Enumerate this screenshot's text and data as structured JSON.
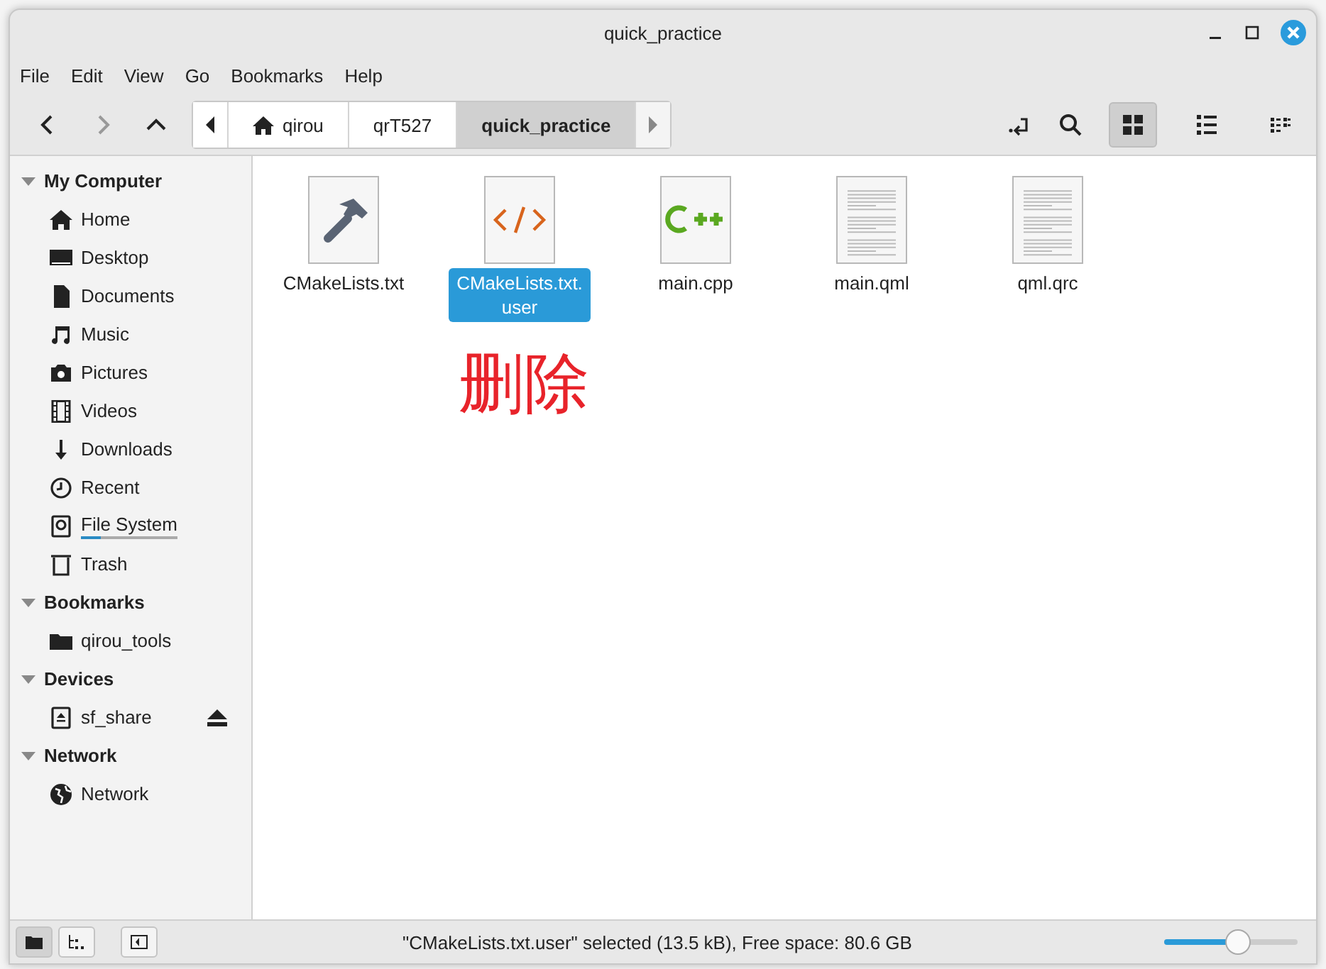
{
  "window": {
    "title": "quick_practice"
  },
  "menu": [
    "File",
    "Edit",
    "View",
    "Go",
    "Bookmarks",
    "Help"
  ],
  "breadcrumbs": [
    {
      "label": "qirou",
      "selected": false
    },
    {
      "label": "qrT527",
      "selected": false
    },
    {
      "label": "quick_practice",
      "selected": true
    }
  ],
  "view_modes": [
    {
      "selected": true
    },
    {
      "selected": false
    },
    {
      "selected": false
    }
  ],
  "sidebar": [
    {
      "label": "My Computer",
      "expanded": true,
      "children": [
        {
          "label": "Home"
        },
        {
          "label": "Desktop"
        },
        {
          "label": "Documents"
        },
        {
          "label": "Music"
        },
        {
          "label": "Pictures"
        },
        {
          "label": "Videos"
        },
        {
          "label": "Downloads"
        },
        {
          "label": "Recent"
        },
        {
          "label": "File System",
          "level": 0.2
        },
        {
          "label": "Trash"
        }
      ]
    },
    {
      "label": "Bookmarks",
      "expanded": true,
      "children": [
        {
          "label": "qirou_tools"
        }
      ]
    },
    {
      "label": "Devices",
      "expanded": true,
      "children": [
        {
          "label": "sf_share"
        }
      ]
    },
    {
      "label": "Network",
      "expanded": true,
      "children": [
        {
          "label": "Network"
        }
      ]
    }
  ],
  "files": [
    {
      "name": "CMakeLists.txt",
      "kind": "cmake",
      "selected": false
    },
    {
      "name": "CMakeLists.txt.user",
      "kind": "code",
      "selected": true
    },
    {
      "name": "main.cpp",
      "kind": "cpp",
      "selected": false
    },
    {
      "name": "main.qml",
      "kind": "text",
      "selected": false
    },
    {
      "name": "qml.qrc",
      "kind": "text",
      "selected": false
    }
  ],
  "annotation": "删除",
  "status_bar": {
    "pane_buttons": [
      {
        "selected": true
      },
      {
        "selected": false
      }
    ],
    "text": "\"CMakeLists.txt.user\" selected (13.5 kB), Free space: 80.6 GB",
    "zoom": {
      "level": 0.5
    }
  }
}
